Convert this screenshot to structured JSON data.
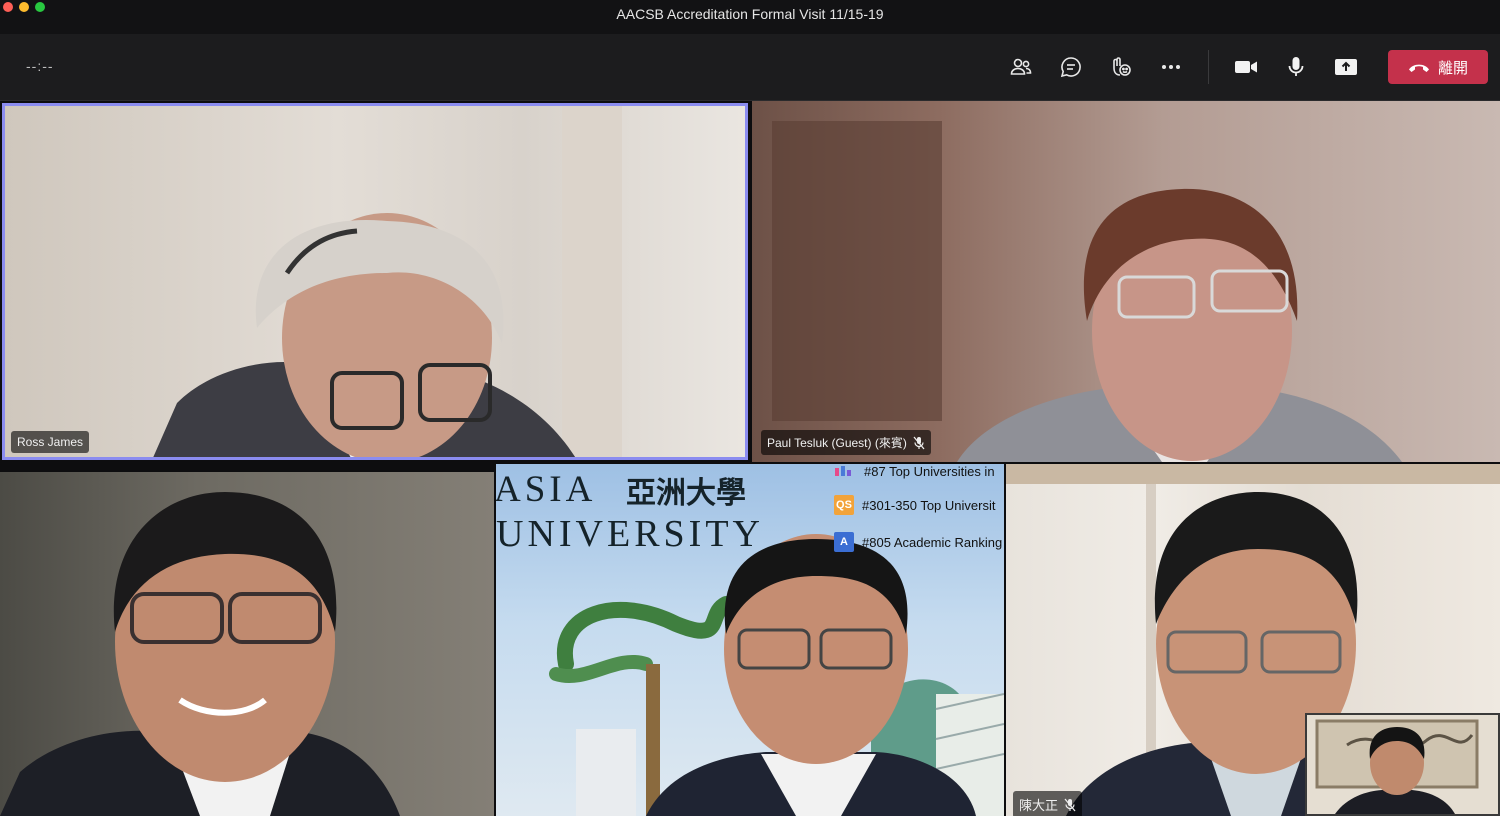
{
  "window": {
    "title": "AACSB Accreditation Formal Visit 11/15-19"
  },
  "toolbar": {
    "timer": "--:--",
    "icons": [
      "participants-icon",
      "chat-icon",
      "reactions-icon",
      "more-icon",
      "camera-icon",
      "microphone-icon",
      "share-icon"
    ],
    "leave_label": "離開"
  },
  "participants": [
    {
      "name": "Ross James",
      "muted": false,
      "active_speaker": true
    },
    {
      "name": "Paul Tesluk (Guest) (來賓)",
      "muted": true
    },
    {
      "name": "",
      "muted": false
    },
    {
      "name": "",
      "muted": false
    },
    {
      "name": "陳大正",
      "muted": true
    }
  ],
  "shared_banner": {
    "title_en_1": "ASIA",
    "title_zh": "亞洲大學",
    "title_en_2": "UNIVERSITY",
    "rankings": [
      {
        "icon": "chart-icon",
        "text": "#87 Top Universities in"
      },
      {
        "icon": "qs-logo-icon",
        "icon_text": "QS",
        "text": "#301-350 Top Universit"
      },
      {
        "icon": "ranking-logo-icon",
        "icon_text": "A",
        "text": "#805 Academic Ranking"
      }
    ]
  },
  "colors": {
    "active_speaker_border": "#8b8cf0",
    "leave_button": "#c4314b"
  }
}
